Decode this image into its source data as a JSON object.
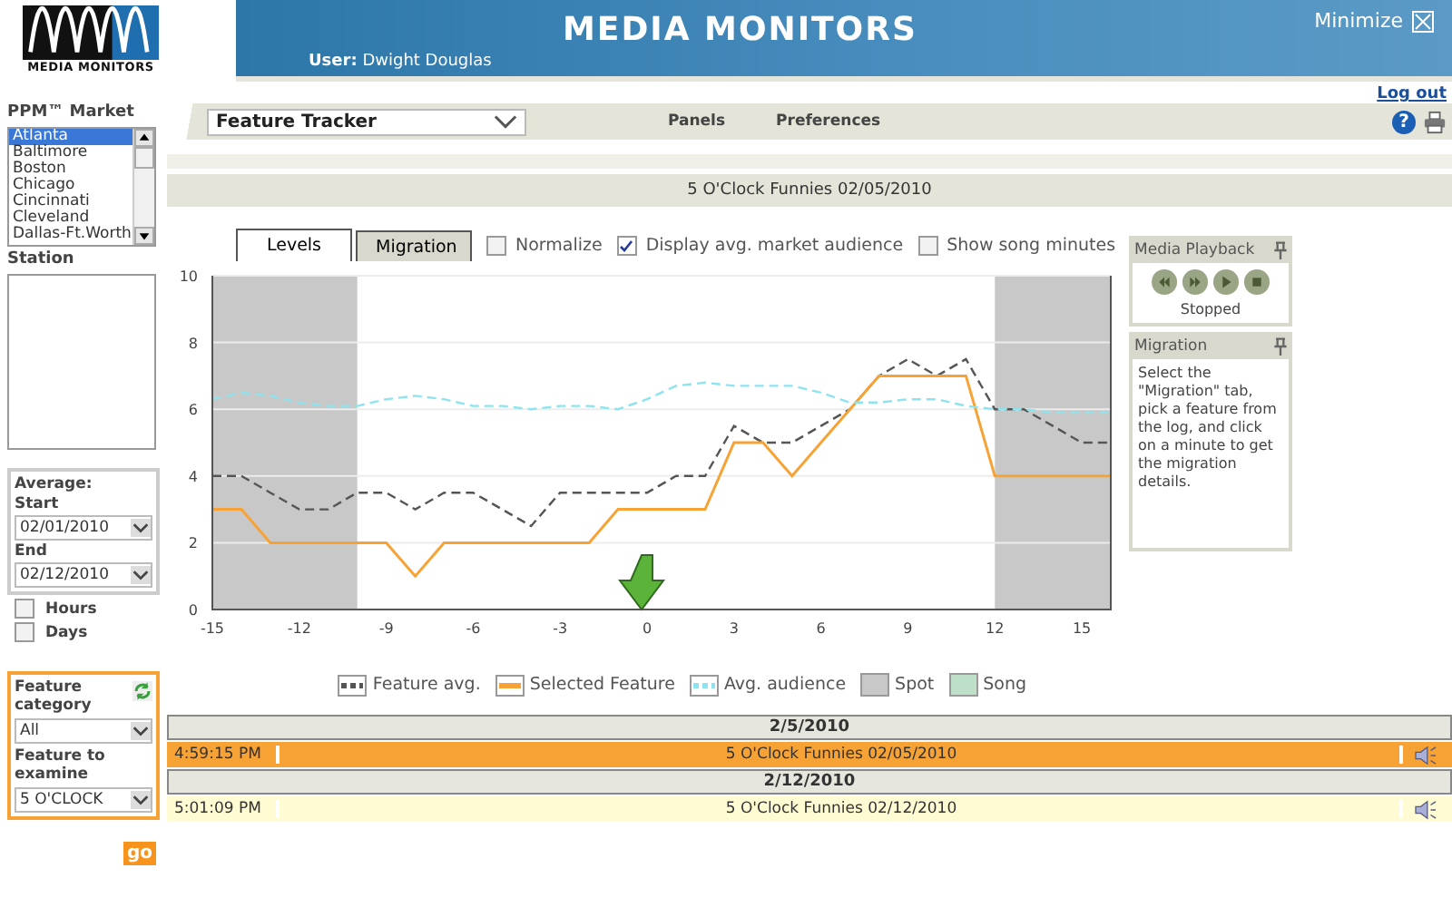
{
  "header": {
    "logo_text": "MEDIA MONITORS",
    "title": "MEDIA MONITORS",
    "user_label": "User:",
    "user_name": "Dwight Douglas",
    "minimize": "Minimize"
  },
  "sidebar": {
    "market_label": "PPM™ Market",
    "markets": [
      {
        "label": "Atlanta",
        "selected": true
      },
      {
        "label": "Baltimore",
        "selected": false
      },
      {
        "label": "Boston",
        "selected": false
      },
      {
        "label": "Chicago",
        "selected": false
      },
      {
        "label": "Cincinnati",
        "selected": false
      },
      {
        "label": "Cleveland",
        "selected": false
      },
      {
        "label": "Dallas-Ft.Worth",
        "selected": false
      }
    ],
    "station_label": "Station",
    "average": {
      "label": "Average:",
      "start_label": "Start",
      "start": "02/01/2010",
      "end_label": "End",
      "end": "02/12/2010"
    },
    "options": [
      {
        "label": "Hours",
        "checked": false
      },
      {
        "label": "Days",
        "checked": false
      }
    ],
    "feature": {
      "category_label": "Feature category",
      "category": "All",
      "examine_label": "Feature to examine",
      "examine": "5 O'CLOCK"
    },
    "go": "go"
  },
  "toolbar": {
    "help": "?",
    "logout": "Log out",
    "view": "Feature Tracker",
    "menu": [
      "Panels",
      "Preferences"
    ]
  },
  "title_band": "5 O'Clock Funnies 02/05/2010",
  "tabs": [
    {
      "label": "Levels",
      "selected": true
    },
    {
      "label": "Migration",
      "selected": false
    }
  ],
  "chart_options": [
    {
      "label": "Normalize",
      "checked": false
    },
    {
      "label": "Display avg. market audience",
      "checked": true
    },
    {
      "label": "Show song minutes",
      "checked": false
    }
  ],
  "chart": {
    "chart_data": {
      "type": "line",
      "x": [
        -15,
        -14,
        -13,
        -12,
        -11,
        -10,
        -9,
        -8,
        -7,
        -6,
        -5,
        -4,
        -3,
        -2,
        -1,
        0,
        1,
        2,
        3,
        4,
        5,
        6,
        7,
        8,
        9,
        10,
        11,
        12,
        13,
        14,
        15,
        16
      ],
      "xlim": [
        -15,
        16
      ],
      "ylim": [
        0,
        10
      ],
      "xticks": [
        -15,
        -12,
        -9,
        -6,
        -3,
        0,
        3,
        6,
        9,
        12,
        15
      ],
      "yticks": [
        0,
        2,
        4,
        6,
        8,
        10
      ],
      "series": [
        {
          "name": "Feature avg.",
          "color": "#555555",
          "line_style": "dashed",
          "values": [
            4,
            4,
            3.5,
            3,
            3,
            3.5,
            3.5,
            3,
            3.5,
            3.5,
            3,
            2.5,
            3.5,
            3.5,
            3.5,
            3.5,
            4,
            4,
            5.5,
            5,
            5,
            5.5,
            6,
            7,
            7.5,
            7,
            7.5,
            6,
            6,
            5.5,
            5,
            5
          ]
        },
        {
          "name": "Selected Feature",
          "color": "#f7a234",
          "line_style": "solid",
          "values": [
            3,
            3,
            2,
            2,
            2,
            2,
            2,
            1,
            2,
            2,
            2,
            2,
            2,
            2,
            3,
            3,
            3,
            3,
            5,
            5,
            4,
            5,
            6,
            7,
            7,
            7,
            7,
            4,
            4,
            4,
            4,
            4
          ]
        },
        {
          "name": "Avg. audience",
          "color": "#8ee4ee",
          "line_style": "dashed",
          "values": [
            6.3,
            6.5,
            6.4,
            6.2,
            6.1,
            6.1,
            6.3,
            6.4,
            6.3,
            6.1,
            6.1,
            6,
            6.1,
            6.1,
            6,
            6.3,
            6.7,
            6.8,
            6.7,
            6.7,
            6.7,
            6.5,
            6.2,
            6.2,
            6.3,
            6.3,
            6.1,
            6,
            6,
            5.9,
            5.9,
            5.9
          ]
        }
      ],
      "grid": true,
      "bands": [
        {
          "axis": "x",
          "from": -15,
          "to": -10,
          "color": "#c8c8c8"
        },
        {
          "axis": "x",
          "from": 12,
          "to": 16,
          "color": "#c8c8c8"
        }
      ]
    },
    "legend_extra": [
      {
        "name": "Spot",
        "color": "#c8c8c8"
      },
      {
        "name": "Song",
        "color": "#bfe0c8"
      }
    ]
  },
  "playback": {
    "title": "Media Playback",
    "status": "Stopped"
  },
  "migration": {
    "title": "Migration",
    "text": "Select the \"Migration\" tab, pick a feature from the log, and click on a minute to get the migration details."
  },
  "log": [
    {
      "date": "2/5/2010",
      "entries": [
        {
          "time": "4:59:15 PM",
          "title": "5 O'Clock Funnies 02/05/2010",
          "selected": true
        }
      ]
    },
    {
      "date": "2/12/2010",
      "entries": [
        {
          "time": "5:01:09 PM",
          "title": "5 O'Clock Funnies 02/12/2010",
          "selected": false
        }
      ]
    }
  ]
}
